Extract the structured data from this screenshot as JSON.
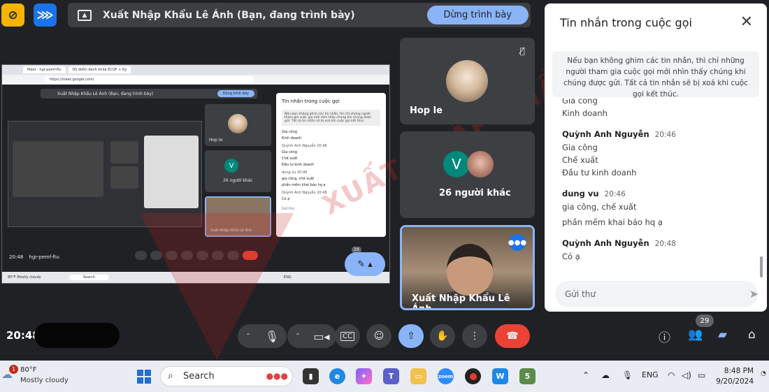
{
  "top_bar": {
    "presenting_text": "Xuất Nhập Khẩu Lê Ánh (Bạn, đang trình bày)",
    "stop_button_label": "Dừng trình bày"
  },
  "shared_screen": {
    "tab1": "Meet - hgr-pemf-ftu",
    "tab2": "DS điểm danh khóa ECQF + Kỹ",
    "url": "https://meet.google.com/",
    "inner_present_text": "Xuất Nhập Khẩu Lê Ánh (Bạn, đang trình bày)",
    "inner_stop_label": "Dừng trình bày",
    "inner_tile1": "Hop le",
    "inner_tile2": "26 người khác",
    "inner_tile3": "Xuất Nhập Khẩu Lê Ánh",
    "inner_chat_title": "Tin nhắn trong cuộc gọi",
    "inner_chat_note": "Nếu bạn không ghim các tin nhắn, thì chỉ những người tham gia cuộc gọi mới nhìn thấy chúng khi chúng được gửi. Tất cả tin nhắn sẽ bị xoá khi cuộc gọi kết thúc.",
    "inner_chat_lines": [
      "Gia công",
      "Kinh doanh"
    ],
    "inner_msg1_name": "Quỳnh Anh Nguyễn",
    "inner_msg1_time": "20:46",
    "inner_msg1_lines": [
      "Gia công",
      "Chế xuất",
      "Đầu tư kinh doanh"
    ],
    "inner_msg2_name": "dung vu",
    "inner_msg2_time": "20:46",
    "inner_msg2_lines": [
      "gia công, chế xuất",
      "phần mềm khai báo hq ạ"
    ],
    "inner_msg3_name": "Quỳnh Anh Nguyễn",
    "inner_msg3_time": "20:48",
    "inner_msg3_lines": [
      "Có ạ"
    ],
    "inner_input": "Gửi thư",
    "inner_time": "20:48",
    "inner_meeting_code": "hgr-pemf-ftu",
    "inner_badge": "29",
    "inner_weather_temp": "80°F",
    "inner_weather_cond": "Mostly cloudy",
    "inner_search": "Search",
    "inner_lang": "ENG"
  },
  "tiles": {
    "tile1_name": "Hop le",
    "tile2_name": "26 người khác",
    "tile2_avatar": "V",
    "tile3_name": "Xuất Nhập Khẩu Lê Ánh"
  },
  "chat": {
    "title": "Tin nhắn trong cuộc gọi",
    "note": "Nếu bạn không ghim các tin nhắn, thì chỉ những người tham gia cuộc gọi mới nhìn thấy chúng khi chúng được gửi. Tất cả tin nhắn sẽ bị xoá khi cuộc gọi kết thúc.",
    "partial_lines": [
      "Gia công",
      "Kinh doanh"
    ],
    "messages": [
      {
        "name": "Quỳnh Anh Nguyễn",
        "time": "20:46",
        "lines": [
          "Gia công",
          "Chế xuất",
          "Đầu tư kinh doanh"
        ]
      },
      {
        "name": "dung vu",
        "time": "20:46",
        "lines": [
          "gia công, chế xuất",
          "phần mềm khai báo hq ạ"
        ]
      },
      {
        "name": "Quỳnh Anh Nguyễn",
        "time": "20:48",
        "lines": [
          "Có ạ"
        ]
      }
    ],
    "input_placeholder": "Gửi thư"
  },
  "controls": {
    "time": "20:48",
    "participants_badge": "29"
  },
  "taskbar": {
    "weather_badge": "1",
    "weather_temp": "80°F",
    "weather_cond": "Mostly cloudy",
    "search_label": "Search",
    "lang": "ENG",
    "clock_time": "8:48 PM",
    "clock_date": "9/20/2024"
  },
  "watermark": {
    "text": "XUẤT NHẬP KHẨU"
  },
  "colors": {
    "accent": "#8ab4f8",
    "end_call": "#ea4335",
    "surface": "#3c4043",
    "background": "#202124"
  }
}
